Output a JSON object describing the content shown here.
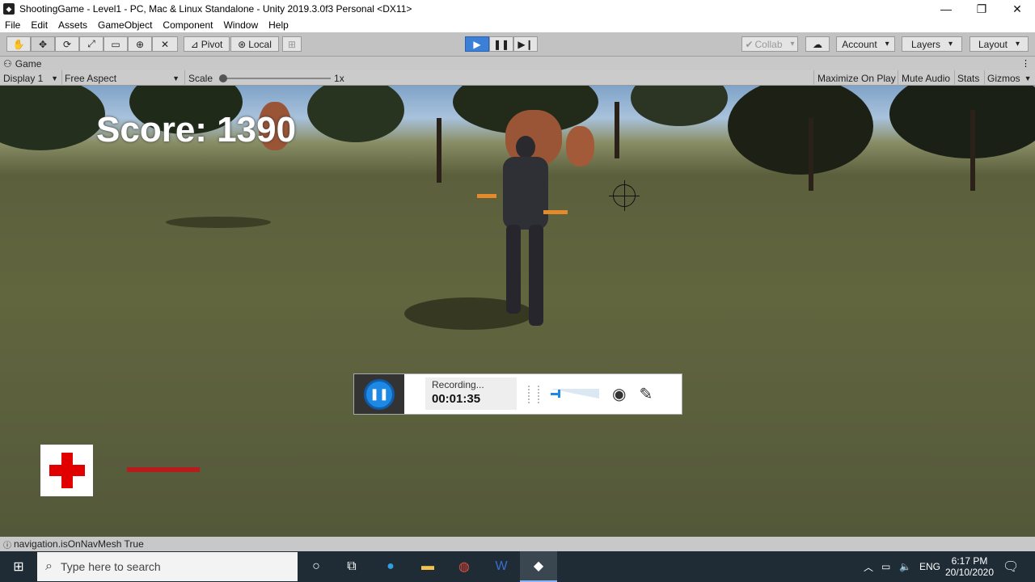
{
  "window": {
    "title": "ShootingGame - Level1 - PC, Mac & Linux Standalone - Unity 2019.3.0f3 Personal <DX11>"
  },
  "menu": [
    "File",
    "Edit",
    "Assets",
    "GameObject",
    "Component",
    "Window",
    "Help"
  ],
  "toolbar": {
    "pivot": "Pivot",
    "local": "Local",
    "collab": "Collab",
    "account": "Account",
    "layers": "Layers",
    "layout": "Layout"
  },
  "game_tab": {
    "label": "Game"
  },
  "game_controls": {
    "display": "Display 1",
    "aspect": "Free Aspect",
    "scale_label": "Scale",
    "scale_value": "1x",
    "scale_level": 0.0,
    "maximize": "Maximize On Play",
    "mute": "Mute Audio",
    "stats": "Stats",
    "gizmos": "Gizmos"
  },
  "hud": {
    "score": "Score: 1390",
    "health_fraction": 0.3
  },
  "recorder": {
    "status": "Recording...",
    "time": "00:01:35",
    "volume_level": 0.15
  },
  "status_bar": {
    "message": "navigation.isOnNavMesh True"
  },
  "taskbar": {
    "search_placeholder": "Type here to search",
    "language": "ENG",
    "time": "6:17 PM",
    "date": "20/10/2020"
  },
  "colors": {
    "accent_play": "#3c7fd6",
    "recorder_button": "#1e88e5",
    "health_cross": "#e00000",
    "health_bar": "#b71c1c"
  }
}
